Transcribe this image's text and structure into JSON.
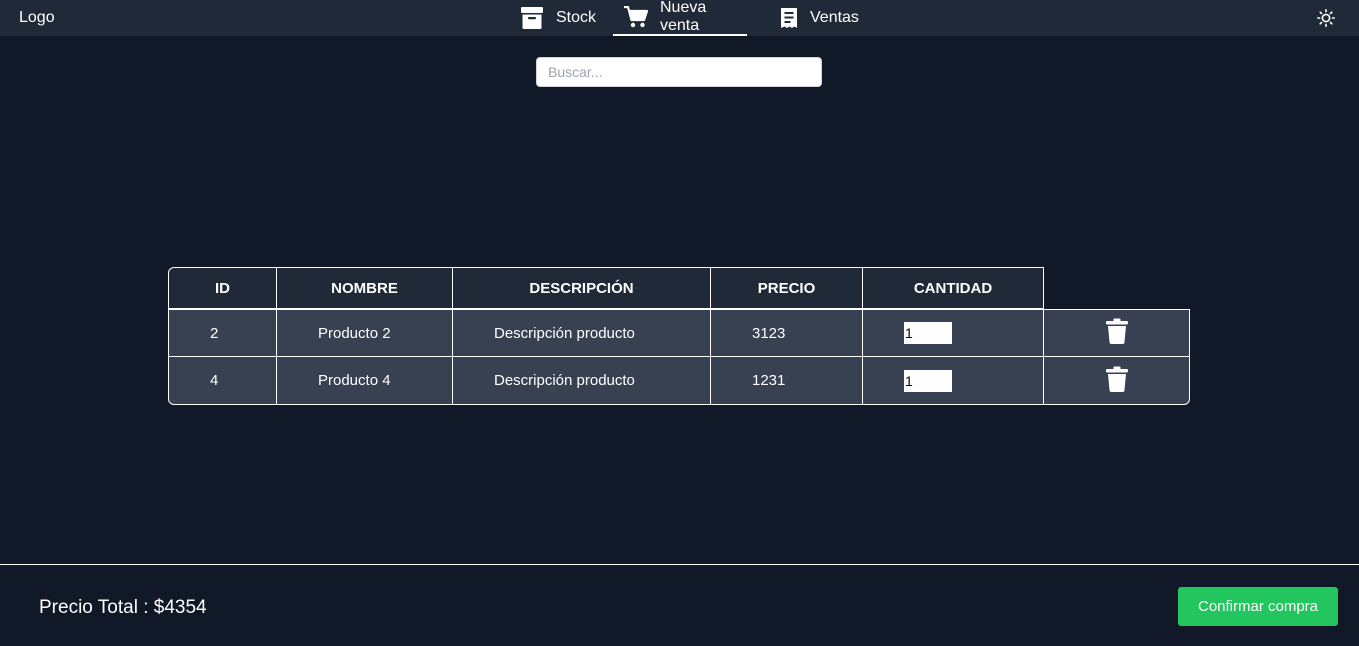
{
  "navbar": {
    "logo": "Logo",
    "items": [
      {
        "label": "Stock",
        "icon": "archive-box-icon"
      },
      {
        "label": "Nueva venta",
        "icon": "shopping-cart-icon",
        "active": true
      },
      {
        "label": "Ventas",
        "icon": "receipt-icon"
      }
    ],
    "theme_icon": "sun-icon"
  },
  "search": {
    "placeholder": "Buscar...",
    "value": ""
  },
  "table": {
    "headers": [
      "ID",
      "NOMBRE",
      "DESCRIPCIÓN",
      "PRECIO",
      "CANTIDAD"
    ],
    "rows": [
      {
        "id": "2",
        "nombre": "Producto 2",
        "descripcion": "Descripción producto",
        "precio": "3123",
        "cantidad": "1"
      },
      {
        "id": "4",
        "nombre": "Producto 4",
        "descripcion": "Descripción producto",
        "precio": "1231",
        "cantidad": "1"
      }
    ],
    "delete_icon": "trash-icon"
  },
  "footer": {
    "total_text": "Precio Total : $4354",
    "confirm_label": "Confirmar compra"
  },
  "colors": {
    "background": "#111827",
    "navbar": "#1f2937",
    "header_cell": "#1f2937",
    "row_cell": "#374151",
    "confirm_button": "#22c55e"
  }
}
